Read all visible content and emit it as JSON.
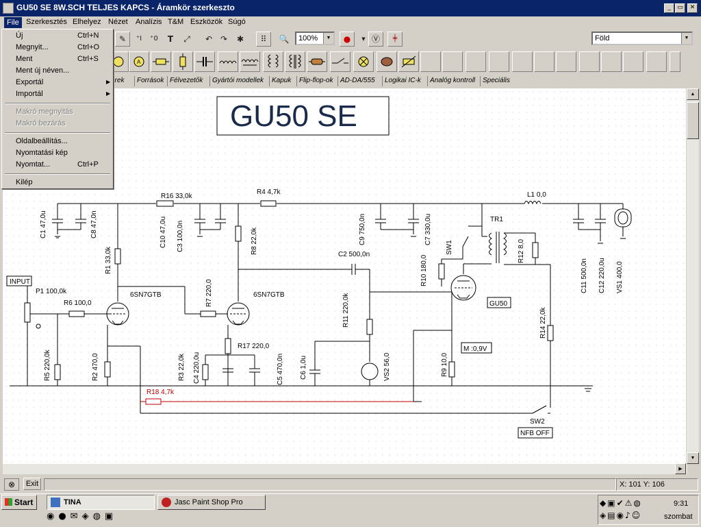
{
  "window": {
    "title": "GU50  SE  8W.SCH TELJES KAPCS - Áramkör szerkeszto",
    "controls": [
      "_",
      "▭",
      "✕"
    ]
  },
  "menu": [
    "File",
    "Szerkesztés",
    "Elhelyez",
    "Nézet",
    "Analízis",
    "T&M",
    "Eszközök",
    "Súgó"
  ],
  "toolbar": {
    "zoom": "100%",
    "ground_select": "Föld"
  },
  "component_tabs": [
    "erek",
    "Források",
    "Félvezetők",
    "Gyártói modellek",
    "Kapuk",
    "Flip-flop-ok",
    "AD-DA/555",
    "Logikai IC-k",
    "Analóg kontroll",
    "Speciális"
  ],
  "file_menu": {
    "items": [
      {
        "label": "Új",
        "shortcut": "Ctrl+N",
        "disabled": false
      },
      {
        "label": "Megnyit...",
        "shortcut": "Ctrl+O",
        "disabled": false
      },
      {
        "label": "Ment",
        "shortcut": "Ctrl+S",
        "disabled": false
      },
      {
        "label": "Ment új néven...",
        "shortcut": "",
        "disabled": false
      },
      {
        "label": "Exportál",
        "shortcut": "",
        "disabled": false
      },
      {
        "label": "Importál",
        "shortcut": "",
        "disabled": false
      },
      {
        "label": "Makró megnyitás",
        "shortcut": "",
        "disabled": true
      },
      {
        "label": "Makró bezárás",
        "shortcut": "",
        "disabled": true
      },
      {
        "label": "Oldalbeállítás...",
        "shortcut": "",
        "disabled": false
      },
      {
        "label": "Nyomtatási kép",
        "shortcut": "",
        "disabled": false
      },
      {
        "label": "Nyomtat...",
        "shortcut": "Ctrl+P",
        "disabled": false
      },
      {
        "label": "Kilép",
        "shortcut": "",
        "disabled": false
      }
    ]
  },
  "schematic": {
    "title": "GU50 SE",
    "labels": {
      "C1": "C1 47,0u",
      "C8": "C8 47,0n",
      "R16": "R16 33,0k",
      "C10": "C10 47,0u",
      "C3": "C3 100,0n",
      "R4": "R4 4,7k",
      "C9": "C9 750,0n",
      "C7": "C7 330,0u",
      "L1": "L1 0,0",
      "TR1": "TR1",
      "C11": "C11 500,0n",
      "C12": "C12 220,0u",
      "VS1": "VS1 400,0",
      "R1": "R1 33,0k",
      "R8": "R8 22,0k",
      "C2": "C2 500,0n",
      "SW1": "SW1",
      "R10": "R10 180,0",
      "R12": "R12 8,0",
      "INPUT": "INPUT",
      "P1": "P1 100,0k",
      "R6": "R6 100,0",
      "tube1": "6SN7GTB",
      "R7": "R7 220,0",
      "tube2": "6SN7GTB",
      "R11": "R11 220,0k",
      "GU50": "GU50",
      "R14": "R14 22,0k",
      "R17": "R17 220,0",
      "meter": "M :0,9V",
      "R5": "R5 220,0k",
      "R2": "R2 470,0",
      "R3": "R3 22,0k",
      "C4": "C4 220,0u",
      "C5": "C5 470,0n",
      "C6": "C6 1,0u",
      "VS2": "VS2 56,0",
      "R9": "R9 10,0",
      "R18": "R18 4,7k",
      "SW2": "SW2",
      "NFB": "NFB OFF"
    }
  },
  "status": {
    "exit": "Exit",
    "coords": "X: 101  Y: 106"
  },
  "taskbar": {
    "start": "Start",
    "tasks": [
      "TINA",
      "Jasc Paint Shop Pro"
    ],
    "clock": "9:31",
    "day": "szombat"
  }
}
